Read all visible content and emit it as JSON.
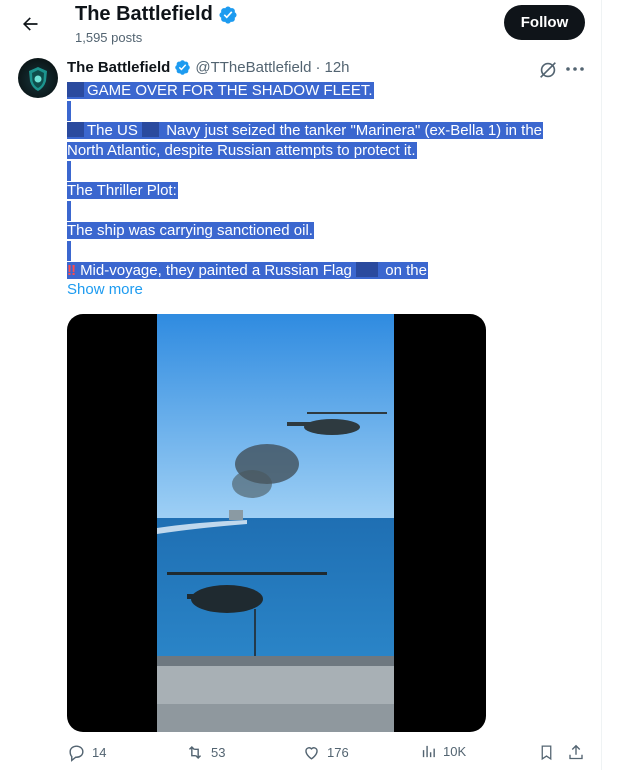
{
  "header": {
    "back_icon": "arrow-left-icon",
    "name": "The Battlefield",
    "post_count": "1,595 posts",
    "follow_label": "Follow"
  },
  "tweet": {
    "author_name": "The Battlefield",
    "author_handle": "@TTheBattlefield",
    "separator": "·",
    "time": "12h",
    "lines": [
      "GAME OVER FOR THE SHADOW FLEET.",
      "The US",
      "Navy just seized the tanker \"Marinera\" (ex-Bella 1) in the",
      "North Atlantic, despite Russian attempts to protect it.",
      "The Thriller Plot:",
      "The ship was carrying sanctioned oil.",
      "Mid-voyage, they painted a Russian Flag",
      "on the"
    ],
    "show_more": "Show more"
  },
  "actions": {
    "replies": "14",
    "reposts": "53",
    "likes": "176",
    "views": "10K"
  },
  "colors": {
    "selection": "#3b67cf",
    "link": "#1d9bf0",
    "verified": "#1d9bf0",
    "follow_bg": "#0f1419"
  }
}
